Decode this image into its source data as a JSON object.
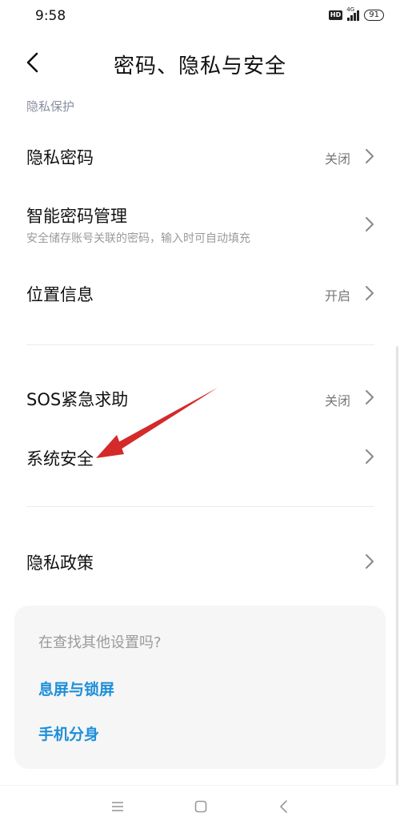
{
  "status": {
    "time": "9:58",
    "hd": "HD",
    "network": "4G",
    "battery": "91"
  },
  "header": {
    "title": "密码、隐私与安全"
  },
  "section": {
    "privacy_label": "隐私保护"
  },
  "rows": {
    "privacy_password": {
      "title": "隐私密码",
      "value": "关闭"
    },
    "smart_password": {
      "title": "智能密码管理",
      "subtitle": "安全储存账号关联的密码，输入时可自动填充"
    },
    "location": {
      "title": "位置信息",
      "value": "开启"
    },
    "sos": {
      "title": "SOS紧急求助",
      "value": "关闭"
    },
    "system_security": {
      "title": "系统安全"
    },
    "privacy_policy": {
      "title": "隐私政策"
    }
  },
  "suggest": {
    "header": "在查找其他设置吗?",
    "links": [
      "息屏与锁屏",
      "手机分身"
    ]
  },
  "colors": {
    "accent": "#1e8fd9",
    "annotation_arrow": "#d42a2a"
  }
}
